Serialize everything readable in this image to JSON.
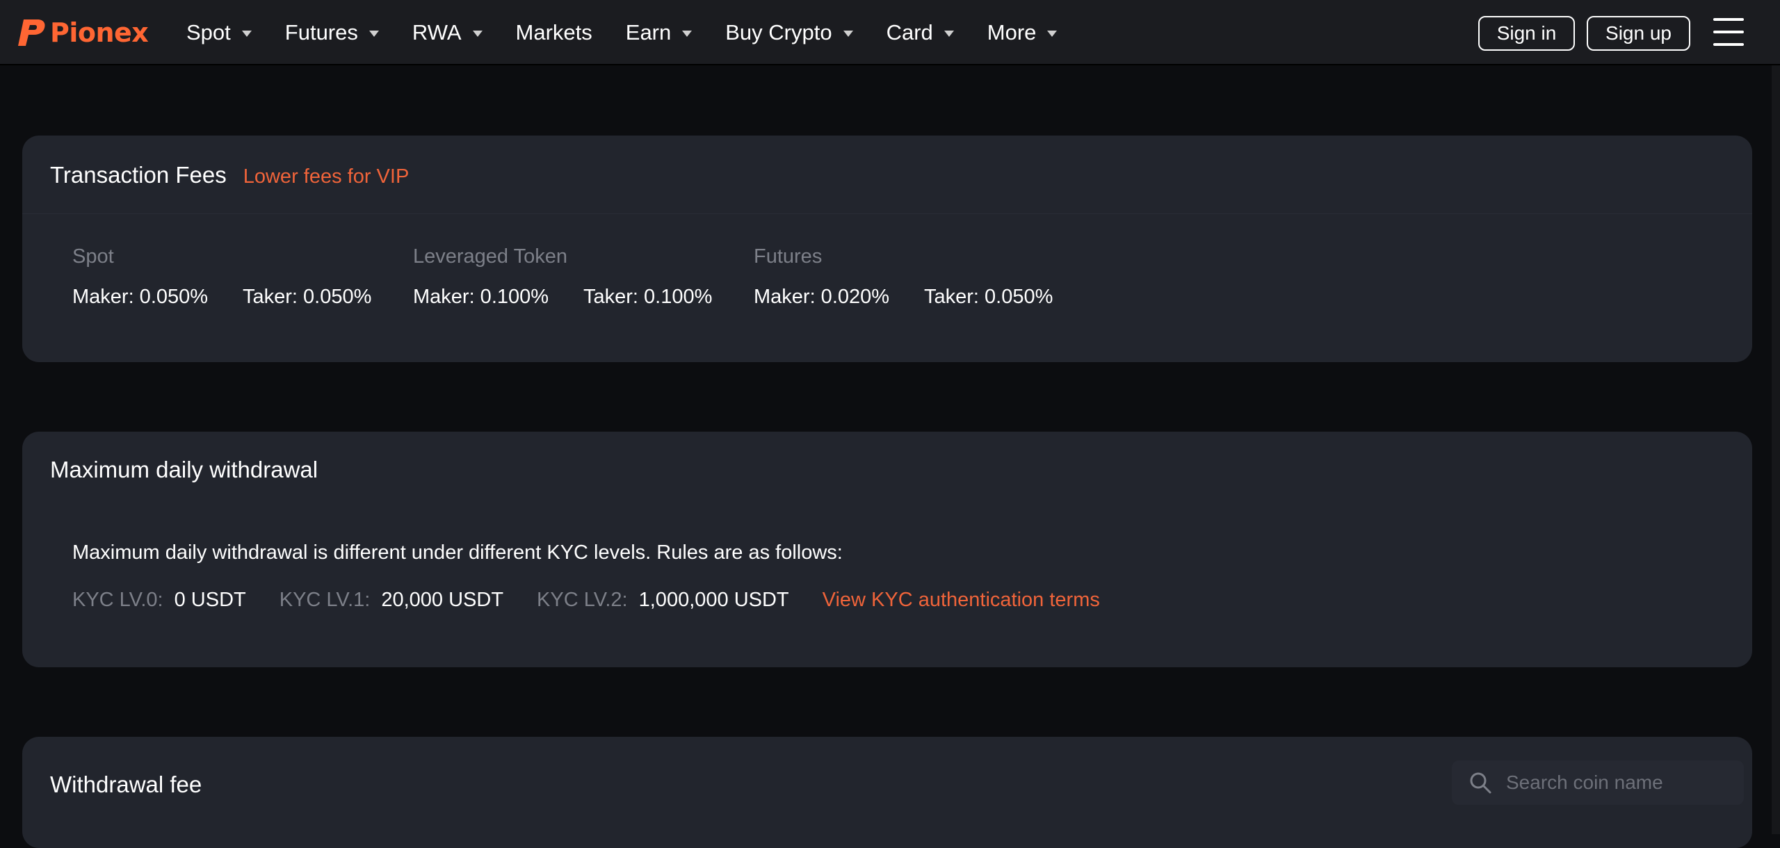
{
  "header": {
    "logo_text": "Pionex",
    "nav": [
      {
        "label": "Spot",
        "has_dropdown": true
      },
      {
        "label": "Futures",
        "has_dropdown": true
      },
      {
        "label": "RWA",
        "has_dropdown": true
      },
      {
        "label": "Markets",
        "has_dropdown": false
      },
      {
        "label": "Earn",
        "has_dropdown": true
      },
      {
        "label": "Buy Crypto",
        "has_dropdown": true
      },
      {
        "label": "Card",
        "has_dropdown": true
      },
      {
        "label": "More",
        "has_dropdown": true
      }
    ],
    "sign_in": "Sign in",
    "sign_up": "Sign up"
  },
  "transaction_fees": {
    "title": "Transaction Fees",
    "vip_link": "Lower fees for VIP",
    "groups": [
      {
        "label": "Spot",
        "maker": "Maker: 0.050%",
        "taker": "Taker: 0.050%"
      },
      {
        "label": "Leveraged Token",
        "maker": "Maker: 0.100%",
        "taker": "Taker: 0.100%"
      },
      {
        "label": "Futures",
        "maker": "Maker: 0.020%",
        "taker": "Taker: 0.050%"
      }
    ]
  },
  "max_withdrawal": {
    "title": "Maximum daily withdrawal",
    "description": "Maximum daily withdrawal is different under different KYC levels. Rules are as follows:",
    "levels": [
      {
        "label": "KYC LV.0:",
        "value": "0 USDT"
      },
      {
        "label": "KYC LV.1:",
        "value": "20,000 USDT"
      },
      {
        "label": "KYC LV.2:",
        "value": "1,000,000 USDT"
      }
    ],
    "terms_link": "View KYC authentication terms"
  },
  "withdrawal_fee": {
    "title": "Withdrawal fee",
    "search_placeholder": "Search coin name"
  },
  "colors": {
    "accent": "#f0643a",
    "logo": "#ff6633",
    "background": "#0c0d10",
    "card": "#22252d",
    "header": "#1b1c20"
  }
}
